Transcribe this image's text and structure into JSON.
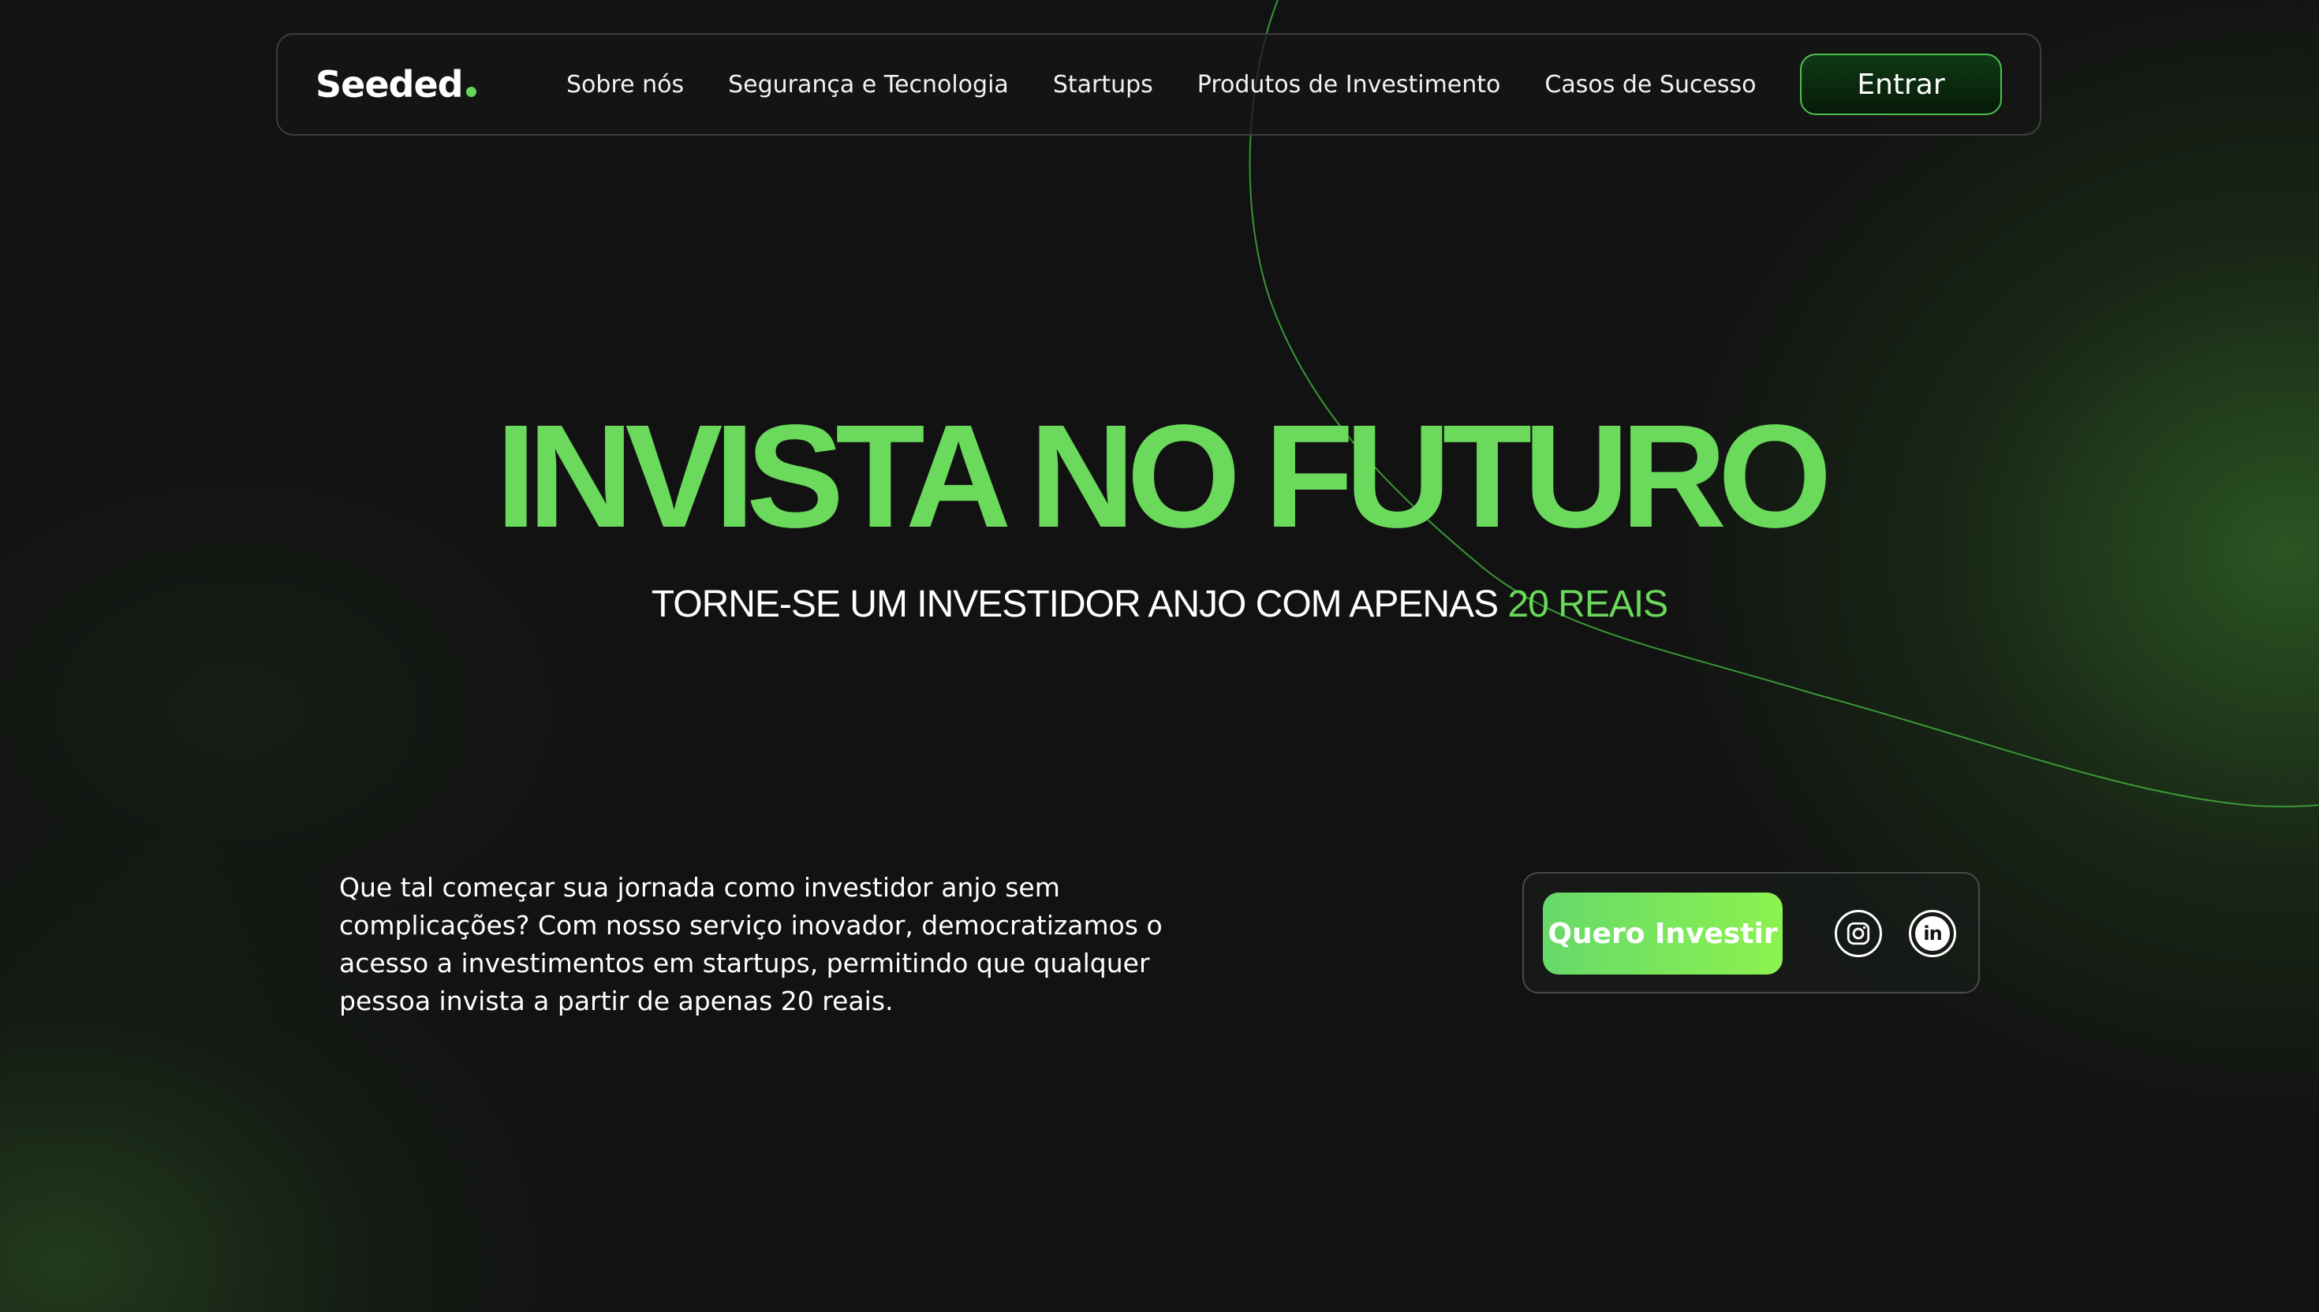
{
  "header": {
    "logo_text": "Seeded",
    "nav": [
      {
        "label": "Sobre nós"
      },
      {
        "label": "Segurança e Tecnologia"
      },
      {
        "label": "Startups"
      },
      {
        "label": "Produtos de Investimento"
      },
      {
        "label": "Casos de Sucesso"
      }
    ],
    "login_label": "Entrar"
  },
  "hero": {
    "title": "INVISTA NO FUTURO",
    "subtitle_prefix": "TORNE-SE UM INVESTIDOR ANJO COM APENAS ",
    "subtitle_highlight": "20 REAIS"
  },
  "intro": {
    "text": "Que tal começar sua jornada como investidor anjo sem complicações? Com nosso serviço inovador, democratizamos o acesso a investimentos em startups, permitindo que qualquer pessoa invista a partir de apenas 20 reais."
  },
  "cta": {
    "invest_label": "Quero Investir",
    "social": [
      {
        "icon": "instagram-icon"
      },
      {
        "icon": "linkedin-icon",
        "glyph": "in"
      }
    ]
  },
  "colors": {
    "accent": "#6ad95c",
    "background": "#121212",
    "button_dark": "#0f3a14"
  }
}
